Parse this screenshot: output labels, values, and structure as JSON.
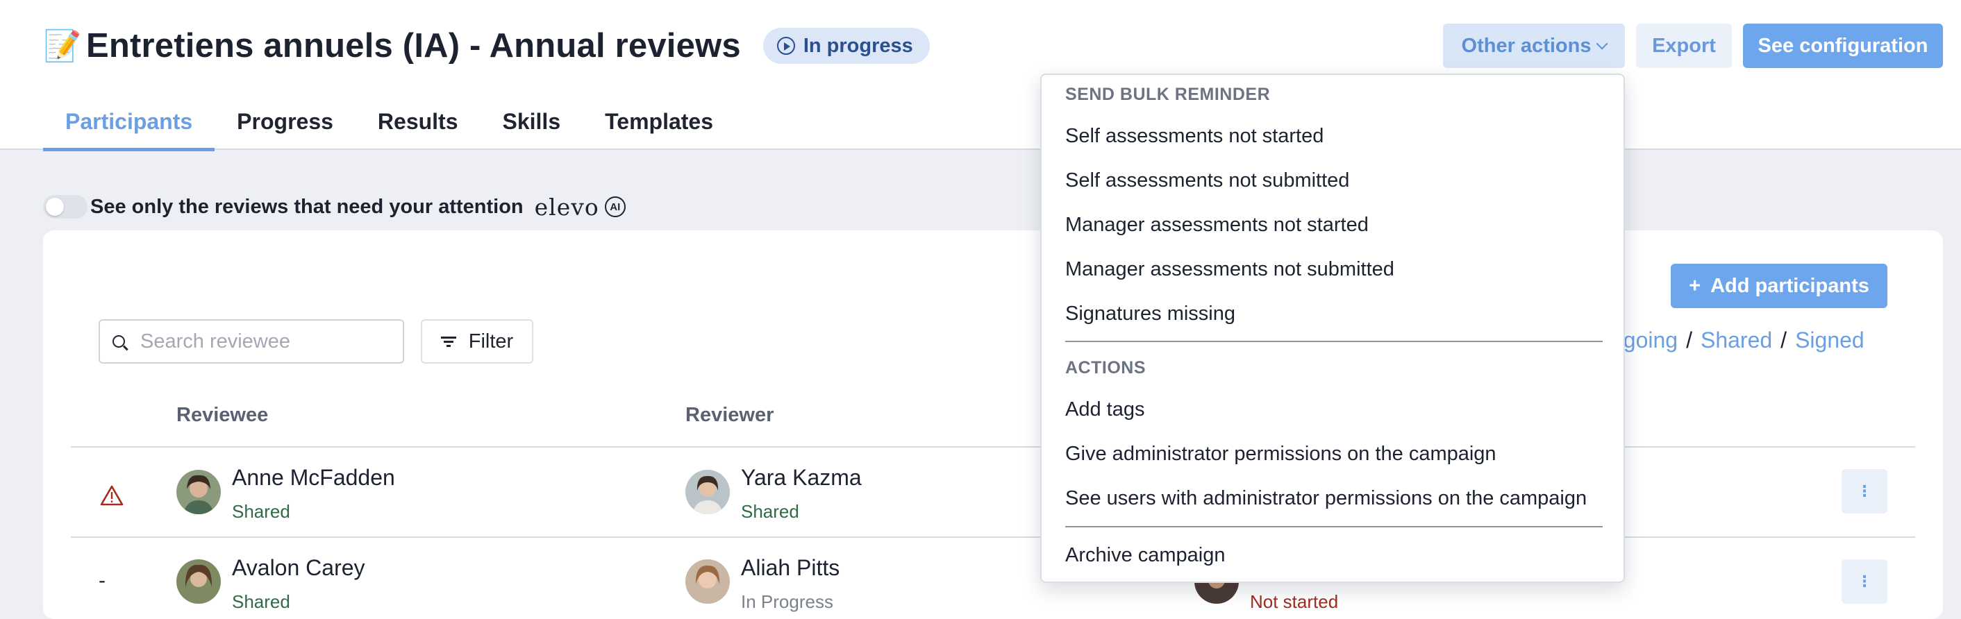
{
  "header": {
    "emoji": "📝",
    "title": "Entretiens annuels (IA) - Annual reviews",
    "status_badge": "In progress",
    "buttons": {
      "other_actions": "Other actions",
      "export": "Export",
      "see_configuration": "See configuration"
    },
    "tabs": [
      {
        "label": "Participants",
        "active": true
      },
      {
        "label": "Progress",
        "active": false
      },
      {
        "label": "Results",
        "active": false
      },
      {
        "label": "Skills",
        "active": false
      },
      {
        "label": "Templates",
        "active": false
      }
    ]
  },
  "filters": {
    "attention_toggle_label": "See only the reviews that need your attention",
    "attention_toggle_on": false,
    "brand": "elevo",
    "ai_badge": "AI",
    "search_placeholder": "Search reviewee",
    "filter_label": "Filter",
    "add_participants_label": "Add participants",
    "status_links": [
      "ngoing",
      "Shared",
      "Signed"
    ],
    "status_separator": "/"
  },
  "table": {
    "columns": {
      "reviewee": "Reviewee",
      "reviewer": "Reviewer"
    },
    "rows": [
      {
        "flag": "warning-icon",
        "reviewee": {
          "name": "Anne McFadden",
          "status": "Shared"
        },
        "reviewer": {
          "name": "Yara Kazma",
          "status": "Shared"
        }
      },
      {
        "flag": "-",
        "reviewee": {
          "name": "Avalon Carey",
          "status": "Shared"
        },
        "reviewer": {
          "name": "Aliah Pitts",
          "status": "In Progress"
        },
        "third_status": "Not started"
      }
    ],
    "more_icon": "⋮"
  },
  "dropdown": {
    "bulk_reminder_header": "SEND BULK REMINDER",
    "bulk_reminder_items": [
      "Self assessments not started",
      "Self assessments not submitted",
      "Manager assessments not started",
      "Manager assessments not submitted",
      "Signatures missing"
    ],
    "actions_header": "ACTIONS",
    "actions_items": [
      "Add tags",
      "Give administrator permissions on the campaign",
      "See users with administrator permissions on the campaign"
    ],
    "archive_item": "Archive campaign"
  },
  "colors": {
    "accent": "#6a9fe4",
    "primary_button": "#6ea6ee",
    "status_shared": "#2f6b47",
    "status_not_started": "#a32b1f",
    "warning": "#a32b1f"
  }
}
